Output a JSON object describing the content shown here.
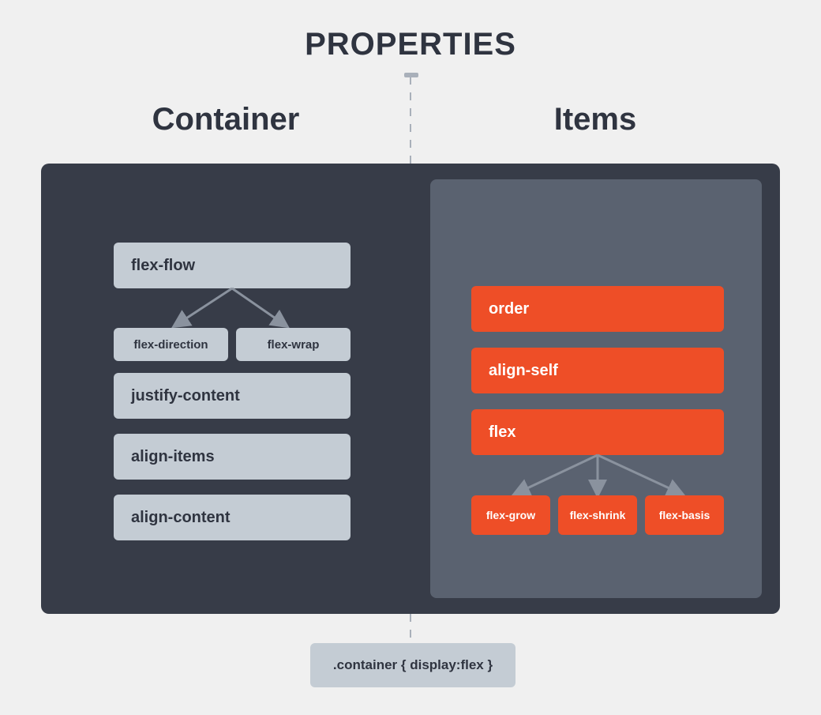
{
  "title": "PROPERTIES",
  "headers": {
    "left": "Container",
    "right": "Items"
  },
  "container_props": {
    "flex_flow": "flex-flow",
    "flex_direction": "flex-direction",
    "flex_wrap": "flex-wrap",
    "justify_content": "justify-content",
    "align_items": "align-items",
    "align_content": "align-content"
  },
  "item_props": {
    "order": "order",
    "align_self": "align-self",
    "flex": "flex",
    "flex_grow": "flex-grow",
    "flex_shrink": "flex-shrink",
    "flex_basis": "flex-basis"
  },
  "code": ".container { display:flex }"
}
